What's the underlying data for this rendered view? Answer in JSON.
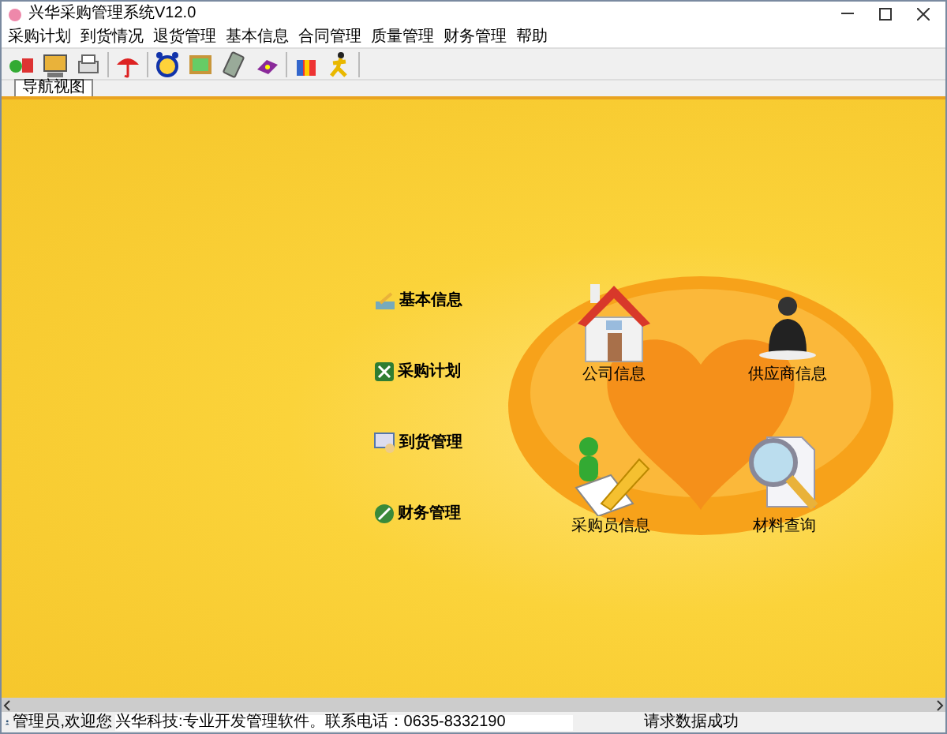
{
  "window": {
    "title": "兴华采购管理系统V12.0"
  },
  "menu": [
    "采购计划",
    "到货情况",
    "退货管理",
    "基本信息",
    "合同管理",
    "质量管理",
    "财务管理",
    "帮助"
  ],
  "tabs": [
    {
      "label": "导航视图",
      "selected": true
    }
  ],
  "nav_links": [
    {
      "label": "基本信息",
      "kind": "info"
    },
    {
      "label": "采购计划",
      "kind": "plan"
    },
    {
      "label": "到货管理",
      "kind": "arrival"
    },
    {
      "label": "财务管理",
      "kind": "finance"
    }
  ],
  "nav_icons": [
    {
      "label": "公司信息",
      "kind": "house"
    },
    {
      "label": "供应商信息",
      "kind": "person"
    },
    {
      "label": "采购员信息",
      "kind": "writer"
    },
    {
      "label": "材料查询",
      "kind": "search"
    }
  ],
  "status_bar": [
    "管理员,欢迎您",
    "兴华科技:专业开发管理软件。联系电话：0635-8332190",
    "请求数据成功"
  ]
}
